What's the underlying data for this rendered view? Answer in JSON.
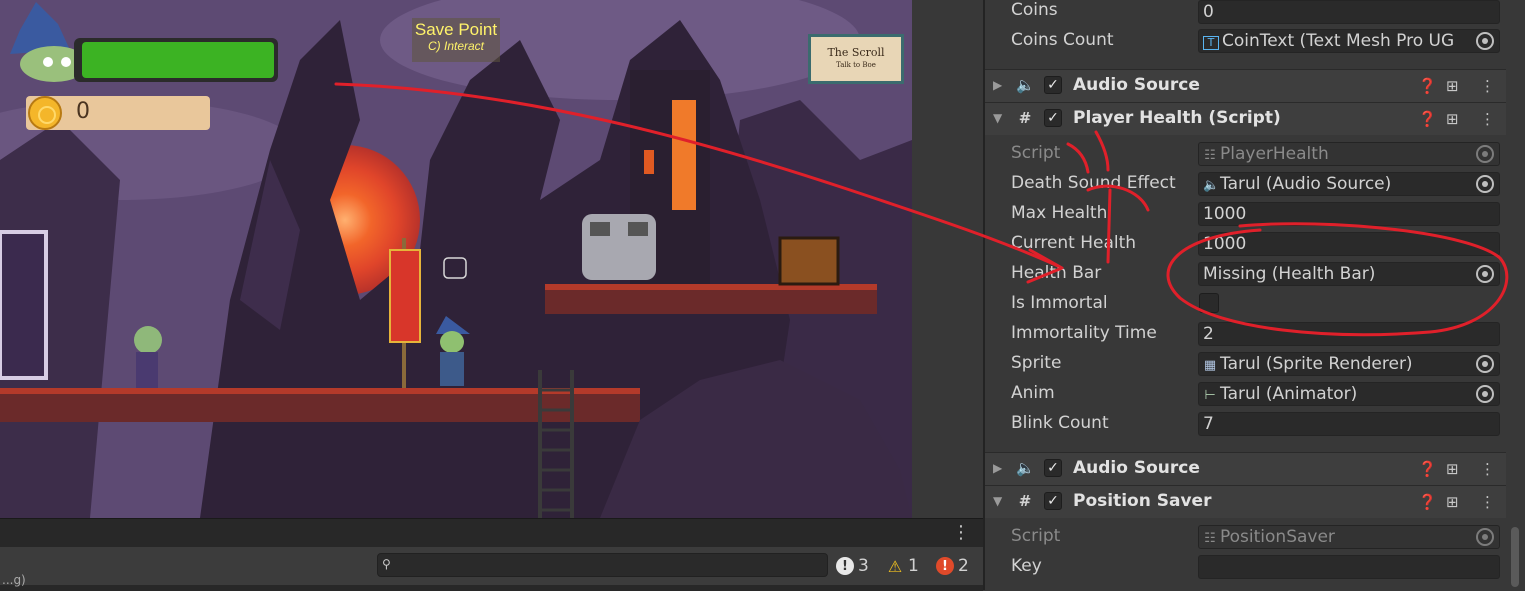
{
  "game": {
    "hud": {
      "coin_count": "0"
    },
    "savepoint": {
      "title": "Save Point",
      "subtitle": "C) Interact"
    },
    "scroll_sign": {
      "title": "The Scroll",
      "subtitle": "Talk to Boe"
    }
  },
  "console": {
    "log_text": "...g)",
    "counts": {
      "messages": "3",
      "warnings": "1",
      "errors": "2"
    },
    "search_placeholder": ""
  },
  "inspector": {
    "top_fields": [
      {
        "label": "Coins",
        "value": "0"
      },
      {
        "label": "Coins Count",
        "value": "CoinText (Text Mesh Pro UG"
      }
    ],
    "audio_source_1": {
      "title": "Audio Source"
    },
    "player_health": {
      "title": "Player Health (Script)",
      "fields": [
        {
          "label": "Script",
          "value": "PlayerHealth"
        },
        {
          "label": "Death Sound Effect",
          "value": "Tarul (Audio Source)"
        },
        {
          "label": "Max Health",
          "value": "1000"
        },
        {
          "label": "Current Health",
          "value": "1000"
        },
        {
          "label": "Health Bar",
          "value": "Missing (Health Bar)"
        },
        {
          "label": "Is Immortal",
          "value": ""
        },
        {
          "label": "Immortality Time",
          "value": "2"
        },
        {
          "label": "Sprite",
          "value": "Tarul (Sprite Renderer)"
        },
        {
          "label": "Anim",
          "value": "Tarul (Animator)"
        },
        {
          "label": "Blink Count",
          "value": "7"
        }
      ]
    },
    "audio_source_2": {
      "title": "Audio Source"
    },
    "position_saver": {
      "title": "Position Saver",
      "fields": [
        {
          "label": "Script",
          "value": "PositionSaver"
        },
        {
          "label": "Key",
          "value": ""
        }
      ]
    }
  },
  "colors": {
    "annotation_red": "#e0202a",
    "health_green": "#3cb323",
    "inspector_bg": "#383838",
    "field_bg": "#2a2a2a"
  },
  "icons": {
    "audio": "audio-source-icon",
    "script": "script-icon",
    "help": "help-icon",
    "presets": "presets-icon",
    "menu": "kebab-menu-icon",
    "picker": "object-picker-icon"
  }
}
